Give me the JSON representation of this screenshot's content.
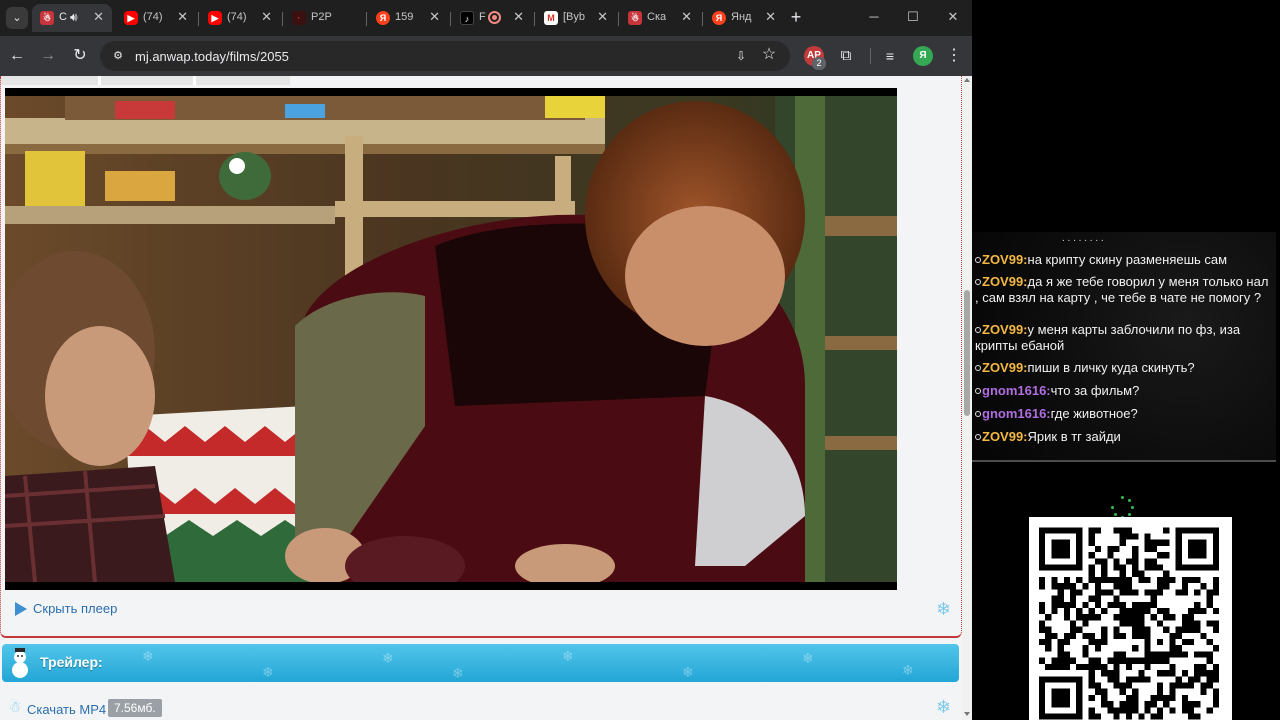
{
  "browser": {
    "tabs": [
      {
        "title": "С",
        "favicon": "snowman-icon",
        "audio": true,
        "active": true
      },
      {
        "title": "(74)",
        "favicon": "youtube-icon",
        "active": false
      },
      {
        "title": "(74)",
        "favicon": "youtube-icon",
        "active": false
      },
      {
        "title": "P2P",
        "favicon": "p2p-icon",
        "active": false
      },
      {
        "title": "159",
        "favicon": "yandex-icon",
        "active": false
      },
      {
        "title": "F",
        "favicon": "tiktok-icon",
        "recording": true,
        "active": false
      },
      {
        "title": "[Byb",
        "favicon": "gmail-icon",
        "active": false
      },
      {
        "title": "Ска",
        "favicon": "snowman-icon",
        "active": false
      },
      {
        "title": "Янд",
        "favicon": "yandex-icon",
        "active": false
      }
    ],
    "url": "mj.anwap.today/films/2055",
    "extension_badge": "2",
    "profile_initial": "Я",
    "ext_label": "AP",
    "yandex_glyph": "Я",
    "gmail_glyph": "M"
  },
  "page": {
    "hide_player_label": "Скрыть плеер",
    "trailer_title": "Трейлер:",
    "download_label": "Скачать MP4",
    "download_size": "7.56мб."
  },
  "chat": {
    "messages": [
      {
        "nick": "ZOV99:",
        "color": "#f5b942",
        "text": "на крипту скину разменяешь сам"
      },
      {
        "nick": "ZOV99:",
        "color": "#f5b942",
        "text": "да я же тебе говорил у меня только нал , сам взял на карту , че тебе в чате не помогу ?"
      },
      {
        "nick": "ZOV99:",
        "color": "#f5b942",
        "text": "у меня карты заблочили по фз, иза крипты ебаной"
      },
      {
        "nick": "ZOV99:",
        "color": "#f5b942",
        "text": "пиши в личку куда скинуть?"
      },
      {
        "nick": "gnom1616:",
        "color": "#b06ee0",
        "text": "что за фильм?"
      },
      {
        "nick": "gnom1616:",
        "color": "#b06ee0",
        "text": "где животное?"
      },
      {
        "nick": "ZOV99:",
        "color": "#f5b942",
        "text": "Ярик в тг зайди"
      }
    ]
  },
  "colors": {
    "accent_blue": "#23a6d6",
    "link_blue": "#2a6eae",
    "frame_red": "#c23a3a"
  }
}
